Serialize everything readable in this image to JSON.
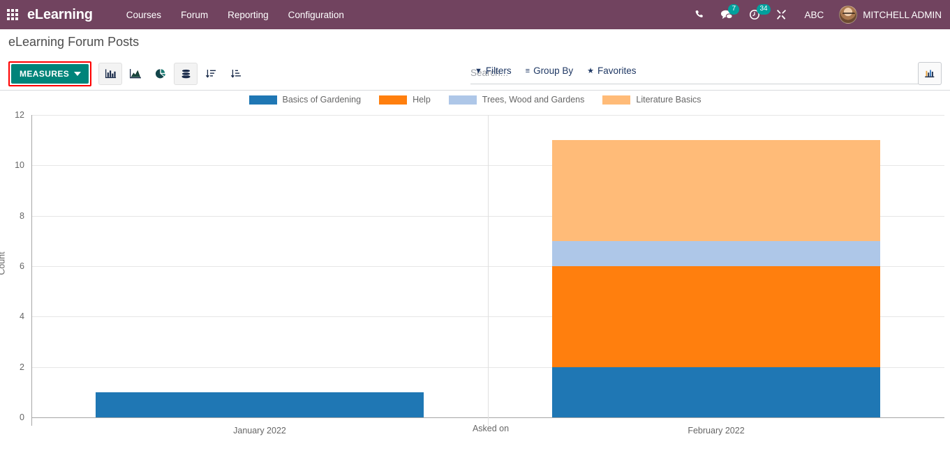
{
  "navbar": {
    "apps_icon": "apps-grid-icon",
    "brand": "eLearning",
    "menu": [
      {
        "label": "Courses"
      },
      {
        "label": "Forum"
      },
      {
        "label": "Reporting"
      },
      {
        "label": "Configuration"
      }
    ],
    "systray": {
      "phone_icon": "phone-icon",
      "messages_icon": "chat-bubble-icon",
      "messages_count": "7",
      "activities_icon": "clock-icon",
      "activities_count": "34",
      "debug_icon": "wrench-icon",
      "language": "ABC",
      "avatar_icon": "user-avatar",
      "user_name": "MITCHELL ADMIN"
    },
    "accent_color": "#71435f",
    "badge_color": "#00a09d"
  },
  "control_panel": {
    "page_title": "eLearning Forum Posts",
    "measures_label": "MEASURES",
    "measures_color": "#00847a",
    "highlight_color": "#ff0000",
    "chart_buttons": [
      {
        "name": "bar-chart-icon",
        "active": true
      },
      {
        "name": "line-chart-icon",
        "active": false
      },
      {
        "name": "pie-chart-icon",
        "active": false
      },
      {
        "name": "stacked-icon",
        "active": true
      },
      {
        "name": "sort-descending-icon",
        "active": false
      },
      {
        "name": "sort-ascending-icon",
        "active": false
      }
    ],
    "search": {
      "placeholder": "Search...",
      "value": "",
      "icon": "search-icon"
    },
    "filters": [
      {
        "glyph": "▼",
        "label": "Filters",
        "name": "filters-dropdown"
      },
      {
        "glyph": "≡",
        "label": "Group By",
        "name": "group-by-dropdown"
      },
      {
        "glyph": "★",
        "label": "Favorites",
        "name": "favorites-dropdown"
      }
    ],
    "view_switch_icon": "graph-view-icon"
  },
  "chart_data": {
    "type": "bar",
    "stacked": true,
    "title": "",
    "xlabel": "Asked on",
    "ylabel": "Count",
    "categories": [
      "January 2022",
      "February 2022"
    ],
    "ylim": [
      0,
      12
    ],
    "yticks": [
      0,
      2,
      4,
      6,
      8,
      10,
      12
    ],
    "grid": true,
    "legend_position": "top",
    "series": [
      {
        "name": "Basics of Gardening",
        "color": "#1f77b4",
        "values": [
          1,
          2
        ]
      },
      {
        "name": "Help",
        "color": "#ff7f0e",
        "values": [
          0,
          4
        ]
      },
      {
        "name": "Trees, Wood and Gardens",
        "color": "#aec7e8",
        "values": [
          0,
          1
        ]
      },
      {
        "name": "Literature Basics",
        "color": "#ffbb78",
        "values": [
          0,
          4
        ]
      }
    ],
    "totals": [
      1,
      11
    ]
  }
}
